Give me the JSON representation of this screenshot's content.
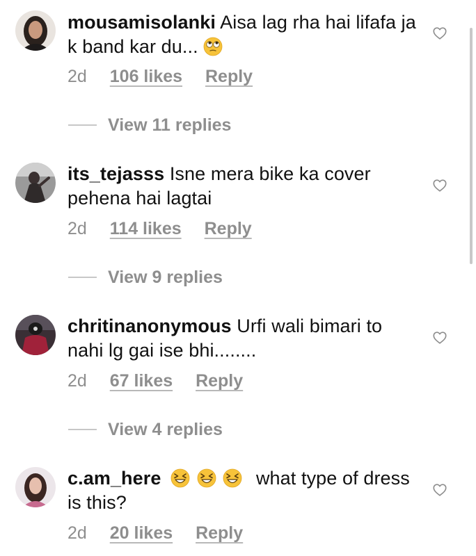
{
  "comments": [
    {
      "username": "mousamisolanki",
      "text": "Aisa lag rha hai lifafa ja k band kar du...",
      "emoji": "face-with-rolling-eyes",
      "time": "2d",
      "likes": "106 likes",
      "reply": "Reply",
      "view_replies": "View 11 replies"
    },
    {
      "username": "its_tejasss",
      "text": "Isne mera bike ka cover pehena hai lagtai",
      "time": "2d",
      "likes": "114 likes",
      "reply": "Reply",
      "view_replies": "View 9 replies"
    },
    {
      "username": "chritinanonymous",
      "text": "Urfi wali bimari to nahi lg gai ise bhi........",
      "time": "2d",
      "likes": "67 likes",
      "reply": "Reply",
      "view_replies": "View 4 replies"
    },
    {
      "username": "c.am_here",
      "emojis": [
        "grinning-squinting-face",
        "grinning-squinting-face",
        "grinning-squinting-face"
      ],
      "text": "what type of dress is this?",
      "time": "2d",
      "likes": "20 likes",
      "reply": "Reply"
    }
  ],
  "colors": {
    "text": "#111111",
    "meta": "#8e8e8e",
    "emoji": "#f7c33a"
  }
}
